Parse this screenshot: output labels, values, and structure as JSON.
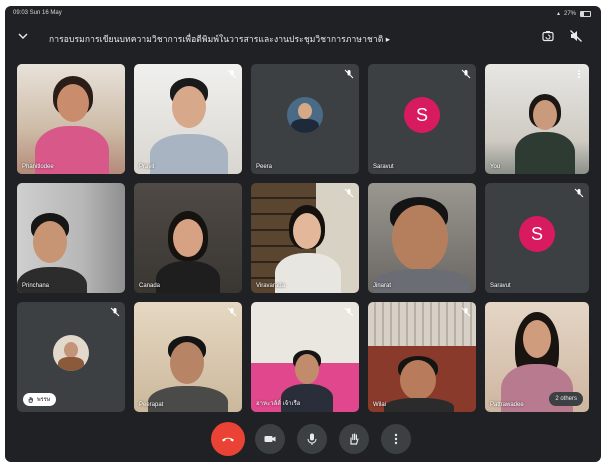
{
  "status_bar": {
    "time_date": "09:03  Sun 16 May",
    "battery": "27%"
  },
  "meeting": {
    "title": "การอบรมการเขียนบทความวิชาการเพื่อตีพิมพ์ในวารสารและงานประชุมวิชาการภาษาชาติ ▸"
  },
  "colors": {
    "background": "#202124",
    "tile": "#3c4043",
    "avatar_pink": "#d81b60",
    "end_call": "#ea4335"
  },
  "participants": [
    {
      "name": "Phanitlodee"
    },
    {
      "name": "Pravit"
    },
    {
      "name": "Peera"
    },
    {
      "name": "Saravut",
      "initial": "S"
    },
    {
      "name": "You"
    },
    {
      "name": "Princhana"
    },
    {
      "name": "Canada"
    },
    {
      "name": "Viravarada"
    },
    {
      "name": "Jinarat"
    },
    {
      "name": "Saravut",
      "initial": "S"
    },
    {
      "name": "",
      "badge": "พรรษ"
    },
    {
      "name": "Peerapat"
    },
    {
      "name": "ฮาหะวล์ส์ เจ้าเรือ"
    },
    {
      "name": "Wilai"
    },
    {
      "name": "Pattrawadee",
      "others": "2 others"
    }
  ],
  "icons": {
    "back": "chevron-down-icon",
    "camera_switch": "camera-switch-icon",
    "speaker": "speaker-off-icon",
    "mic_off": "mic-off-icon",
    "end": "end-call-icon",
    "camera": "camera-icon",
    "mic": "mic-icon",
    "hand": "raise-hand-icon",
    "more": "more-vert-icon"
  }
}
